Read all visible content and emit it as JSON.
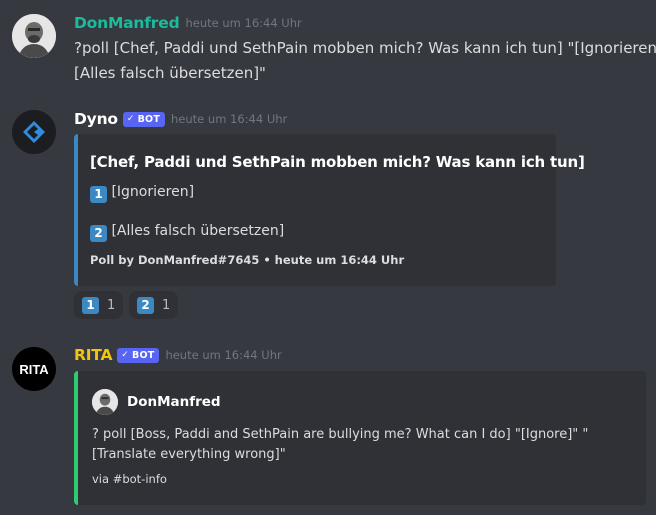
{
  "messages": {
    "user": {
      "username": "DonManfred",
      "username_color": "#1abc9c",
      "timestamp": "heute um 16:44 Uhr",
      "line1": "?poll [Chef, Paddi und SethPain mobben mich? Was kann ich tun] \"[Ignorieren]\"",
      "line2": "[Alles falsch übersetzen]\""
    },
    "dyno": {
      "username": "Dyno",
      "badge": "BOT",
      "timestamp": "heute um 16:44 Uhr",
      "embed": {
        "accent": "#3b88c3",
        "title": "[Chef, Paddi und SethPain mobben mich? Was kann ich tun]",
        "option1_num": "1",
        "option1": "[Ignorieren]",
        "option2_num": "2",
        "option2": "[Alles falsch übersetzen]",
        "footer": "Poll by DonManfred#7645 • heute um 16:44 Uhr"
      },
      "reactions": [
        {
          "emoji": "1",
          "count": "1"
        },
        {
          "emoji": "2",
          "count": "1"
        }
      ]
    },
    "rita": {
      "username": "RITA",
      "username_color": "#f1c40f",
      "avatar_text": "RITA",
      "badge": "BOT",
      "timestamp": "heute um 16:44 Uhr",
      "embed": {
        "accent": "#2ecc71",
        "author": "DonManfred",
        "line1": "? poll [Boss, Paddi and SethPain are bullying me? What can I do] \"[Ignore]\" \"",
        "line2": "[Translate everything wrong]\"",
        "footer": "via #bot-info"
      }
    }
  }
}
